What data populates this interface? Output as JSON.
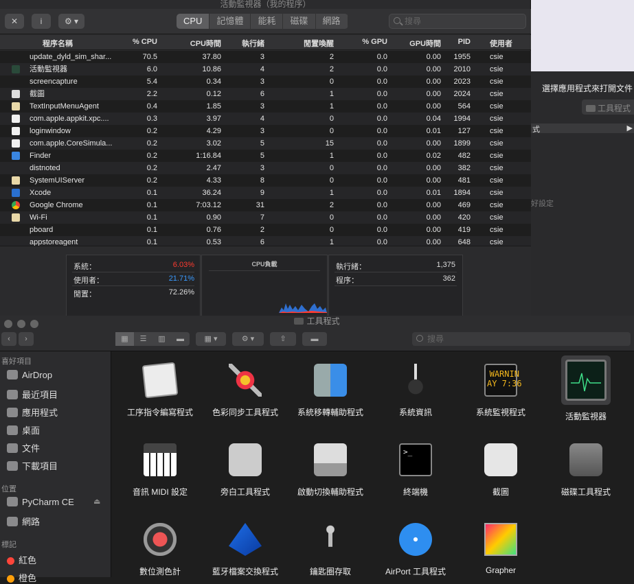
{
  "activity_monitor": {
    "title": "活動監視器（我的程序）",
    "toolbar": {
      "close_label": "✕",
      "info_label": "i",
      "gear_label": "⚙ ▾"
    },
    "tabs": [
      "CPU",
      "記憶體",
      "能耗",
      "磁碟",
      "網路"
    ],
    "active_tab": "CPU",
    "search_placeholder": "搜尋",
    "columns": [
      "程序名稱",
      "% CPU",
      "CPU時間",
      "執行緒",
      "閒置喚醒",
      "% GPU",
      "GPU時間",
      "PID",
      "使用者"
    ],
    "rows": [
      [
        "update_dyld_sim_shar...",
        "70.5",
        "37.80",
        "3",
        "2",
        "0.0",
        "0.00",
        "1955",
        "csie"
      ],
      [
        "活動監視器",
        "6.0",
        "10.86",
        "4",
        "2",
        "0.0",
        "0.00",
        "2010",
        "csie"
      ],
      [
        "screencapture",
        "5.4",
        "0.34",
        "3",
        "0",
        "0.0",
        "0.00",
        "2023",
        "csie"
      ],
      [
        "截圖",
        "2.2",
        "0.12",
        "6",
        "1",
        "0.0",
        "0.00",
        "2024",
        "csie"
      ],
      [
        "TextInputMenuAgent",
        "0.4",
        "1.85",
        "3",
        "1",
        "0.0",
        "0.00",
        "564",
        "csie"
      ],
      [
        "com.apple.appkit.xpc....",
        "0.3",
        "3.97",
        "4",
        "0",
        "0.0",
        "0.04",
        "1994",
        "csie"
      ],
      [
        "loginwindow",
        "0.2",
        "4.29",
        "3",
        "0",
        "0.0",
        "0.01",
        "127",
        "csie"
      ],
      [
        "com.apple.CoreSimula...",
        "0.2",
        "3.02",
        "5",
        "15",
        "0.0",
        "0.00",
        "1899",
        "csie"
      ],
      [
        "Finder",
        "0.2",
        "1:16.84",
        "5",
        "1",
        "0.0",
        "0.02",
        "482",
        "csie"
      ],
      [
        "distnoted",
        "0.2",
        "2.47",
        "3",
        "0",
        "0.0",
        "0.00",
        "382",
        "csie"
      ],
      [
        "SystemUIServer",
        "0.2",
        "4.33",
        "8",
        "0",
        "0.0",
        "0.00",
        "481",
        "csie"
      ],
      [
        "Xcode",
        "0.1",
        "36.24",
        "9",
        "1",
        "0.0",
        "0.01",
        "1894",
        "csie"
      ],
      [
        "Google Chrome",
        "0.1",
        "7:03.12",
        "31",
        "2",
        "0.0",
        "0.00",
        "469",
        "csie"
      ],
      [
        "Wi-Fi",
        "0.1",
        "0.90",
        "7",
        "0",
        "0.0",
        "0.00",
        "420",
        "csie"
      ],
      [
        "pboard",
        "0.1",
        "0.76",
        "2",
        "0",
        "0.0",
        "0.00",
        "419",
        "csie"
      ],
      [
        "appstoreagent",
        "0.1",
        "0.53",
        "6",
        "1",
        "0.0",
        "0.00",
        "648",
        "csie"
      ]
    ],
    "row_icons": [
      "none",
      "monitor",
      "none",
      "screenshot",
      "generic-app",
      "doc",
      "doc",
      "doc",
      "finder",
      "none",
      "generic-app",
      "xcode",
      "chrome",
      "generic-app",
      "none",
      "none"
    ],
    "stats": {
      "system_label": "系統：",
      "system_value": "6.03%",
      "user_label": "使用者：",
      "user_value": "21.71%",
      "idle_label": "閒置：",
      "idle_value": "72.26%",
      "cpu_load_title": "CPU負載",
      "threads_label": "執行緒：",
      "threads_value": "1,375",
      "processes_label": "程序：",
      "processes_value": "362"
    },
    "colors": {
      "system": "#ff3b30",
      "user": "#3b9bff"
    }
  },
  "background_window": {
    "hint": "選擇應用程式來打開文件「",
    "button": "工具程式",
    "frag1": "式",
    "frag2": "好設定"
  },
  "finder": {
    "title": "工具程式",
    "search_placeholder": "搜尋",
    "sidebar": {
      "favorites_header": "喜好項目",
      "favorites": [
        {
          "label": "AirDrop",
          "icon": "airdrop-icon"
        },
        {
          "label": "最近項目",
          "icon": "recents-icon"
        },
        {
          "label": "應用程式",
          "icon": "applications-icon"
        },
        {
          "label": "桌面",
          "icon": "desktop-icon"
        },
        {
          "label": "文件",
          "icon": "documents-icon"
        },
        {
          "label": "下載項目",
          "icon": "downloads-icon"
        }
      ],
      "locations_header": "位置",
      "locations": [
        {
          "label": "PyCharm CE",
          "icon": "disk-icon"
        },
        {
          "label": "網路",
          "icon": "network-icon"
        }
      ],
      "tags_header": "標記",
      "tags": [
        {
          "label": "紅色",
          "color": "#ff453a"
        },
        {
          "label": "橙色",
          "color": "#ff9f0a"
        }
      ]
    },
    "apps": [
      {
        "label": "工序指令編寫程式",
        "icon": "script-editor-icon"
      },
      {
        "label": "色彩同步工具程式",
        "icon": "colorsync-icon"
      },
      {
        "label": "系統移轉輔助程式",
        "icon": "migration-assistant-icon"
      },
      {
        "label": "系統資訊",
        "icon": "system-information-icon"
      },
      {
        "label": "系統監視程式",
        "icon": "console-icon",
        "console_text": "WARNIN\nAY 7:36"
      },
      {
        "label": "活動監視器",
        "icon": "activity-monitor-icon",
        "selected": true
      },
      {
        "label": "音訊 MIDI 設定",
        "icon": "audio-midi-icon"
      },
      {
        "label": "旁白工具程式",
        "icon": "voiceover-icon"
      },
      {
        "label": "啟動切換輔助程式",
        "icon": "boot-camp-icon"
      },
      {
        "label": "終端機",
        "icon": "terminal-icon"
      },
      {
        "label": "截圖",
        "icon": "screenshot-icon"
      },
      {
        "label": "磁碟工具程式",
        "icon": "disk-utility-icon"
      },
      {
        "label": "數位測色計",
        "icon": "digital-color-meter-icon"
      },
      {
        "label": "藍牙檔案交換程式",
        "icon": "bluetooth-icon"
      },
      {
        "label": "鑰匙圈存取",
        "icon": "keychain-icon"
      },
      {
        "label": "AirPort 工具程式",
        "icon": "airport-icon"
      },
      {
        "label": "Grapher",
        "icon": "grapher-icon"
      }
    ]
  }
}
